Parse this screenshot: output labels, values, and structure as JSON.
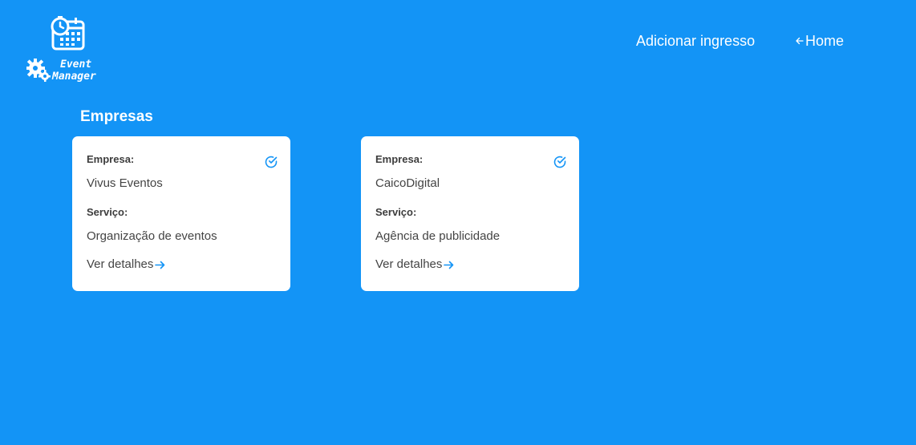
{
  "logo": {
    "line1": "Event",
    "line2": "Manager"
  },
  "nav": {
    "add_ticket": "Adicionar ingresso",
    "home": "Home"
  },
  "section": {
    "title": "Empresas"
  },
  "cards": [
    {
      "company_label": "Empresa:",
      "company": "Vivus Eventos",
      "service_label": "Serviço:",
      "service": "Organização de eventos",
      "details": "Ver detalhes"
    },
    {
      "company_label": "Empresa:",
      "company": "CaicoDigital",
      "service_label": "Serviço:",
      "service": "Agência de publicidade",
      "details": "Ver detalhes"
    }
  ],
  "colors": {
    "background": "#1394f6",
    "card": "#ffffff",
    "accent": "#1394f6",
    "text": "#444444"
  },
  "icons": {
    "logo": "calendar-clock-gears-icon",
    "home_arrow": "arrow-left-icon",
    "card_check": "check-circle-icon",
    "details_arrow": "arrow-right-icon"
  }
}
